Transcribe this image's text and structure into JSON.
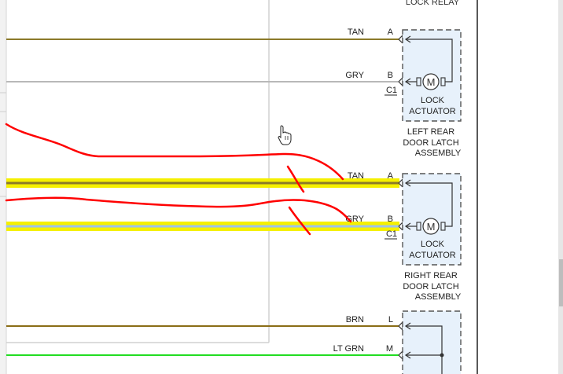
{
  "header": {
    "cut_label": "LOCK RELAY"
  },
  "cursor": {
    "icon": "hand-pointer-icon"
  },
  "colors": {
    "tan": "#8b7a2a",
    "gray": "#b8b8b8",
    "brn": "#8a6d16",
    "lt_grn": "#22dd22",
    "highlight": "#f5f000",
    "annotation": "#ff0000",
    "module_fill": "#e7f1fb"
  },
  "wires": {
    "w1": {
      "color": "TAN",
      "pin": "A"
    },
    "w2": {
      "color": "GRY",
      "pin": "B",
      "connector": "C1"
    },
    "w3": {
      "color": "TAN",
      "pin": "A"
    },
    "w4": {
      "color": "GRY",
      "pin": "B",
      "connector": "C1"
    },
    "w5": {
      "color": "BRN",
      "pin": "L"
    },
    "w6": {
      "color": "LT GRN",
      "pin": "M"
    }
  },
  "components": {
    "left_rear": {
      "motor_symbol": "M",
      "actuator_line1": "LOCK",
      "actuator_line2": "ACTUATOR",
      "assembly_line1": "LEFT REAR",
      "assembly_line2": "DOOR LATCH",
      "assembly_line3": "ASSEMBLY"
    },
    "right_rear": {
      "motor_symbol": "M",
      "actuator_line1": "LOCK",
      "actuator_line2": "ACTUATOR",
      "assembly_line1": "RIGHT REAR",
      "assembly_line2": "DOOR LATCH",
      "assembly_line3": "ASSEMBLY"
    }
  }
}
